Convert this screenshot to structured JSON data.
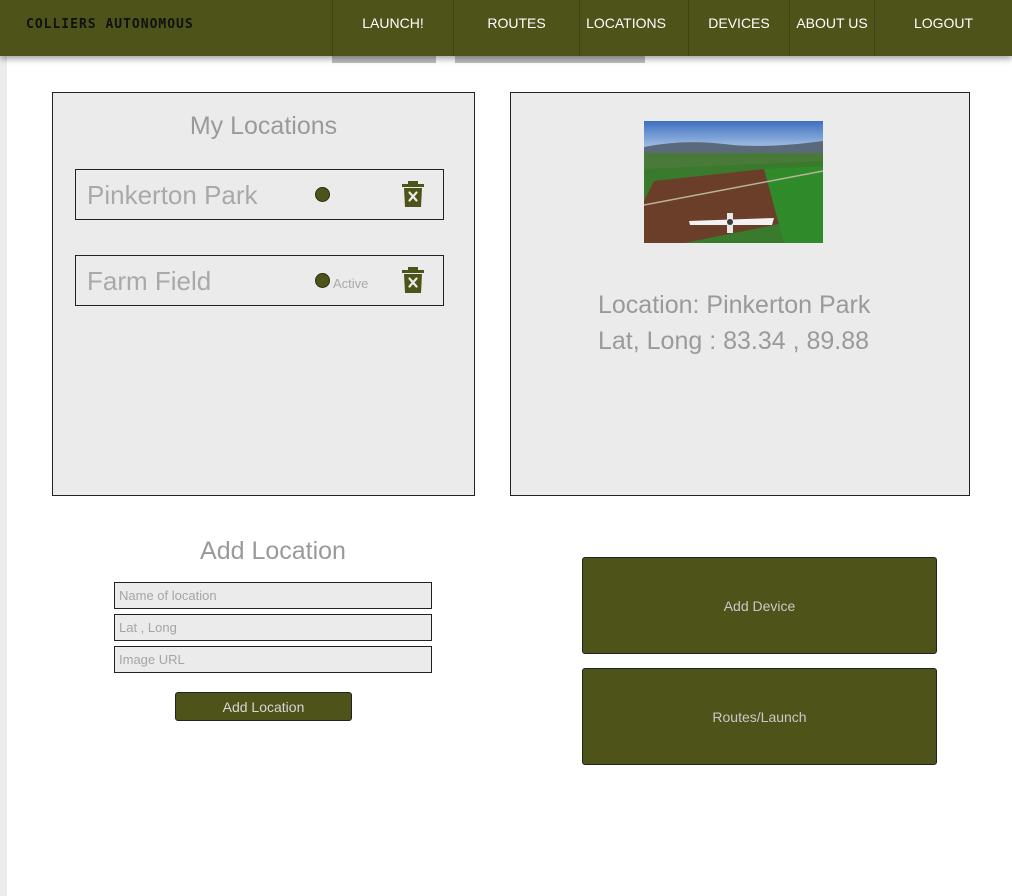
{
  "nav": {
    "brand": "COLLIERS AUTONOMOUS",
    "items": [
      {
        "label": "LAUNCH!"
      },
      {
        "label": "ROUTES"
      },
      {
        "label": "LOCATIONS"
      },
      {
        "label": "DEVICES"
      },
      {
        "label": "ABOUT US"
      },
      {
        "label": "LOGOUT"
      }
    ]
  },
  "locations_panel": {
    "title": "My Locations",
    "items": [
      {
        "name": "Pinkerton Park",
        "status": ""
      },
      {
        "name": "Farm Field",
        "status": "Active"
      }
    ]
  },
  "detail_panel": {
    "location_line": "Location: Pinkerton Park",
    "coords_line": "Lat, Long : 83.34 , 89.88"
  },
  "add_location": {
    "title": "Add Location",
    "name_placeholder": "Name of location",
    "latlong_placeholder": "Lat , Long",
    "image_placeholder": "Image URL",
    "button_label": "Add Location"
  },
  "actions": {
    "add_device": "Add Device",
    "routes_launch": "Routes/Launch"
  },
  "colors": {
    "brand_olive": "#4d5319",
    "panel_bg": "#ebebeb",
    "muted_text": "#9a9a9a"
  }
}
